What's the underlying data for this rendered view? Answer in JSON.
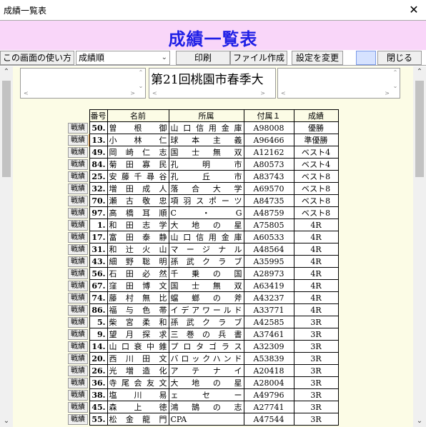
{
  "window": {
    "title": "成績一覧表",
    "close_glyph": "✕"
  },
  "banner": {
    "title": "成績一覧表",
    "color": "#1f1fe6",
    "background": "#f9d6f9"
  },
  "toolbar": {
    "help_label": "この画面の使い方",
    "sort_select": "成績順",
    "print_label": "印刷",
    "file_label": "ファイル作成",
    "settings_label": "設定を変更",
    "close_label": "閉じる"
  },
  "event_title": "第21回桃園市春季大",
  "table": {
    "headers": {
      "number": "番号",
      "name": "名前",
      "affiliation": "所属",
      "card": "付属１",
      "result": "成績"
    },
    "row_button": "戦績",
    "rows": [
      {
        "number": "50.",
        "name": "曽根御",
        "affiliation": "山口信用金庫",
        "card": "A98008",
        "result": "優勝"
      },
      {
        "number": "13.",
        "name": "小林仁",
        "affiliation": "球本主義",
        "card": "A96466",
        "result": "準優勝"
      },
      {
        "number": "49.",
        "name": "岡崎仁志",
        "affiliation": "国士無双",
        "card": "A12162",
        "result": "ベスト4"
      },
      {
        "number": "84.",
        "name": "菊田寡民",
        "affiliation": "孔明市",
        "card": "A80573",
        "result": "ベスト4"
      },
      {
        "number": "25.",
        "name": "安藤千尋谷",
        "affiliation": "孔丘市",
        "card": "A83743",
        "result": "ベスト8"
      },
      {
        "number": "32.",
        "name": "増田成人",
        "affiliation": "落合大学",
        "card": "A69570",
        "result": "ベスト8"
      },
      {
        "number": "70.",
        "name": "瀬古敬忠",
        "affiliation": "項羽スポーツ",
        "card": "A84735",
        "result": "ベスト8"
      },
      {
        "number": "97.",
        "name": "高橋耳順",
        "affiliation": "C・G",
        "card": "A48759",
        "result": "ベスト8"
      },
      {
        "number": "1.",
        "name": "和田志学",
        "affiliation": "大地の星",
        "card": "A75805",
        "result": "4R"
      },
      {
        "number": "17.",
        "name": "富田泰静",
        "affiliation": "山口信用金庫",
        "card": "A60533",
        "result": "4R"
      },
      {
        "number": "31.",
        "name": "和辻火山",
        "affiliation": "マージナル",
        "card": "A48564",
        "result": "4R"
      },
      {
        "number": "43.",
        "name": "細野聡明",
        "affiliation": "孫武クラブ",
        "card": "A35995",
        "result": "4R"
      },
      {
        "number": "56.",
        "name": "石田必然",
        "affiliation": "千乗の国",
        "card": "A28973",
        "result": "4R"
      },
      {
        "number": "67.",
        "name": "窪田博文",
        "affiliation": "国士無双",
        "card": "A63419",
        "result": "4R"
      },
      {
        "number": "74.",
        "name": "藤村無比",
        "affiliation": "蟷螂の斧",
        "card": "A43237",
        "result": "4R"
      },
      {
        "number": "86.",
        "name": "福与色帯",
        "affiliation": "イデアワールド",
        "card": "A33771",
        "result": "4R"
      },
      {
        "number": "5.",
        "name": "柴宮柔和",
        "affiliation": "孫武クラブ",
        "card": "A42585",
        "result": "3R"
      },
      {
        "number": "9.",
        "name": "望月探求",
        "affiliation": "三巻の兵書",
        "card": "A37461",
        "result": "3R"
      },
      {
        "number": "14.",
        "name": "山口衰中錐",
        "affiliation": "プロタゴラス",
        "card": "A32309",
        "result": "3R"
      },
      {
        "number": "20.",
        "name": "西川田文",
        "affiliation": "バロックハンド",
        "card": "A53839",
        "result": "3R"
      },
      {
        "number": "26.",
        "name": "光増造化",
        "affiliation": "アテナイ",
        "card": "A20418",
        "result": "3R"
      },
      {
        "number": "36.",
        "name": "寺尾会友文",
        "affiliation": "大地の星",
        "card": "A28004",
        "result": "3R"
      },
      {
        "number": "38.",
        "name": "塩川易",
        "affiliation": "ェセー",
        "card": "A49796",
        "result": "3R"
      },
      {
        "number": "45.",
        "name": "森上徳",
        "affiliation": "鴻鵠の志",
        "card": "A27741",
        "result": "3R"
      },
      {
        "number": "55.",
        "name": "松金龍門",
        "affiliation": "CPA",
        "card": "A47544",
        "result": "3R"
      }
    ]
  }
}
